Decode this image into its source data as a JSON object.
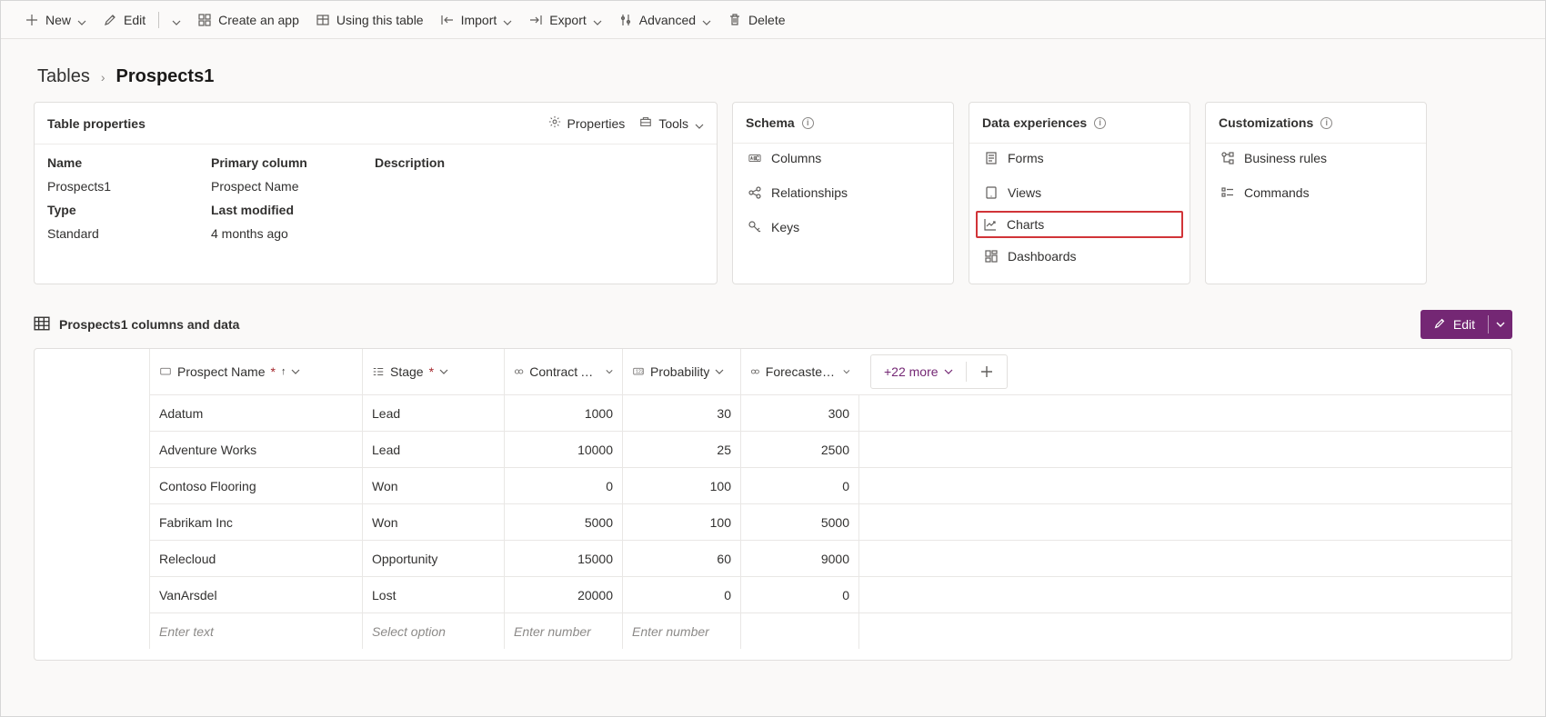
{
  "toolbar": {
    "new": "New",
    "edit": "Edit",
    "createApp": "Create an app",
    "usingTable": "Using this table",
    "import": "Import",
    "export": "Export",
    "advanced": "Advanced",
    "delete": "Delete"
  },
  "breadcrumb": {
    "root": "Tables",
    "current": "Prospects1"
  },
  "propsCard": {
    "title": "Table properties",
    "propertiesLink": "Properties",
    "toolsLink": "Tools",
    "name_lbl": "Name",
    "name_val": "Prospects1",
    "primary_lbl": "Primary column",
    "primary_val": "Prospect Name",
    "desc_lbl": "Description",
    "type_lbl": "Type",
    "type_val": "Standard",
    "modified_lbl": "Last modified",
    "modified_val": "4 months ago"
  },
  "schema": {
    "title": "Schema",
    "columns": "Columns",
    "relationships": "Relationships",
    "keys": "Keys"
  },
  "dataExp": {
    "title": "Data experiences",
    "forms": "Forms",
    "views": "Views",
    "charts": "Charts",
    "dashboards": "Dashboards"
  },
  "custom": {
    "title": "Customizations",
    "br": "Business rules",
    "cmds": "Commands"
  },
  "tableSec": {
    "title": "Prospects1 columns and data",
    "editBtn": "Edit"
  },
  "columns": {
    "name": "Prospect Name",
    "stage": "Stage",
    "amount": "Contract Amo...",
    "prob": "Probability",
    "forecast": "Forecasted Re...",
    "more": "+22 more"
  },
  "rows": [
    {
      "name": "Adatum",
      "stage": "Lead",
      "amount": "1000",
      "prob": "30",
      "forecast": "300"
    },
    {
      "name": "Adventure Works",
      "stage": "Lead",
      "amount": "10000",
      "prob": "25",
      "forecast": "2500"
    },
    {
      "name": "Contoso Flooring",
      "stage": "Won",
      "amount": "0",
      "prob": "100",
      "forecast": "0"
    },
    {
      "name": "Fabrikam Inc",
      "stage": "Won",
      "amount": "5000",
      "prob": "100",
      "forecast": "5000"
    },
    {
      "name": "Relecloud",
      "stage": "Opportunity",
      "amount": "15000",
      "prob": "60",
      "forecast": "9000"
    },
    {
      "name": "VanArsdel",
      "stage": "Lost",
      "amount": "20000",
      "prob": "0",
      "forecast": "0"
    }
  ],
  "placeholders": {
    "name": "Enter text",
    "stage": "Select option",
    "amount": "Enter number",
    "prob": "Enter number"
  }
}
